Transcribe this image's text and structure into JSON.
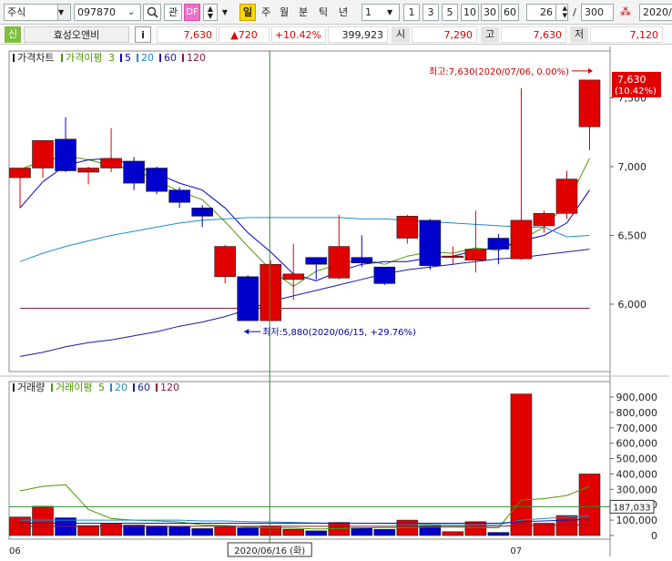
{
  "toolbar": {
    "market": "주식",
    "code": "097870",
    "btn_tube": "관",
    "btn_df": "DF",
    "periods": [
      "일",
      "주",
      "월",
      "분",
      "틱",
      "년"
    ],
    "interval_value": "1",
    "quick_counts": [
      "1",
      "3",
      "5",
      "10",
      "30",
      "60"
    ],
    "view_count": "26",
    "separator": "/",
    "total_count": "300",
    "date_partial": "2020/"
  },
  "info": {
    "tag": "신",
    "name": "효성오앤비",
    "info_btn": "i",
    "price": "7,630",
    "change": "▲720",
    "change_pct": "+10.42%",
    "volume": "399,923",
    "open_label": "시",
    "open": "7,290",
    "high_label": "고",
    "high": "7,630",
    "low_label": "저",
    "low": "7,120"
  },
  "colors": {
    "up": "#e00000",
    "down": "#0000cc",
    "ma3": "#4a9a00",
    "ma5": "#0000cc",
    "ma20": "#1e8ec8",
    "ma60": "#1a1a9e",
    "ma120": "#8b1a3a",
    "cursor": "#2e8b2e"
  },
  "chart_data": {
    "type": "candlestick",
    "legend_price": {
      "title": "가격차트",
      "ma_title": "가격이평",
      "periods": [
        "3",
        "5",
        "20",
        "60",
        "120"
      ]
    },
    "legend_volume": {
      "title": "거래량",
      "ma_title": "거래이평",
      "periods": [
        "5",
        "20",
        "60",
        "120"
      ]
    },
    "price_ticks": [
      {
        "value": 6000,
        "label": "6,000"
      },
      {
        "value": 6500,
        "label": "6,500"
      },
      {
        "value": 7000,
        "label": "7,000"
      },
      {
        "value": 7500,
        "label": "7,500"
      }
    ],
    "volume_ticks": [
      {
        "value": 0,
        "label": "0"
      },
      {
        "value": 100000,
        "label": "100,000"
      },
      {
        "value": 200000,
        "label": "200,000"
      },
      {
        "value": 300000,
        "label": "300,000"
      },
      {
        "value": 400000,
        "label": "400,000"
      },
      {
        "value": 500000,
        "label": "500,000"
      },
      {
        "value": 600000,
        "label": "600,000"
      },
      {
        "value": 700000,
        "label": "700,000"
      },
      {
        "value": 800000,
        "label": "800,000"
      },
      {
        "value": 900000,
        "label": "900,000"
      }
    ],
    "current_price_label": "7,630",
    "current_pct_label": "(10.42%)",
    "volume_marker_value": 187033,
    "volume_marker_label": "187,033",
    "max_annotation": "최고:7,630(2020/07/06, 0.00%)",
    "min_annotation": "최저:5,880(2020/06/15, +29.76%)",
    "cursor_date_label": "2020/06/16 (화)",
    "x_labels": [
      {
        "index": 0,
        "label": "06"
      },
      {
        "index": 22,
        "label": "07"
      }
    ],
    "cursor_index": 11,
    "candles": [
      {
        "o": 6920,
        "h": 6980,
        "l": 6700,
        "c": 6990,
        "v": 120000
      },
      {
        "o": 6990,
        "h": 7100,
        "l": 6920,
        "c": 7190,
        "v": 190000
      },
      {
        "o": 7200,
        "h": 7360,
        "l": 6960,
        "c": 6970,
        "v": 115000
      },
      {
        "o": 6960,
        "h": 7000,
        "l": 6870,
        "c": 6990,
        "v": 65000
      },
      {
        "o": 6990,
        "h": 7280,
        "l": 6960,
        "c": 7060,
        "v": 80000
      },
      {
        "o": 7040,
        "h": 7070,
        "l": 6830,
        "c": 6880,
        "v": 68000
      },
      {
        "o": 6990,
        "h": 7000,
        "l": 6800,
        "c": 6820,
        "v": 62000
      },
      {
        "o": 6830,
        "h": 6850,
        "l": 6700,
        "c": 6740,
        "v": 58000
      },
      {
        "o": 6700,
        "h": 6720,
        "l": 6560,
        "c": 6640,
        "v": 45000
      },
      {
        "o": 6200,
        "h": 6430,
        "l": 6150,
        "c": 6420,
        "v": 55000
      },
      {
        "o": 6200,
        "h": 6210,
        "l": 5880,
        "c": 5880,
        "v": 50000
      },
      {
        "o": 5880,
        "h": 6320,
        "l": 5880,
        "c": 6290,
        "v": 62000
      },
      {
        "o": 6180,
        "h": 6440,
        "l": 6030,
        "c": 6220,
        "v": 40000
      },
      {
        "o": 6340,
        "h": 6340,
        "l": 6180,
        "c": 6290,
        "v": 30000
      },
      {
        "o": 6190,
        "h": 6650,
        "l": 6180,
        "c": 6420,
        "v": 85000
      },
      {
        "o": 6340,
        "h": 6500,
        "l": 6270,
        "c": 6300,
        "v": 50000
      },
      {
        "o": 6270,
        "h": 6270,
        "l": 6140,
        "c": 6150,
        "v": 40000
      },
      {
        "o": 6480,
        "h": 6650,
        "l": 6440,
        "c": 6640,
        "v": 100000
      },
      {
        "o": 6610,
        "h": 6620,
        "l": 6250,
        "c": 6280,
        "v": 65000
      },
      {
        "o": 6350,
        "h": 6420,
        "l": 6290,
        "c": 6350,
        "v": 25000
      },
      {
        "o": 6320,
        "h": 6680,
        "l": 6230,
        "c": 6400,
        "v": 90000
      },
      {
        "o": 6480,
        "h": 6510,
        "l": 6290,
        "c": 6400,
        "v": 20000
      },
      {
        "o": 6330,
        "h": 7570,
        "l": 6320,
        "c": 6610,
        "v": 920000
      },
      {
        "o": 6570,
        "h": 6680,
        "l": 6520,
        "c": 6660,
        "v": 80000
      },
      {
        "o": 6660,
        "h": 6970,
        "l": 6620,
        "c": 6910,
        "v": 130000
      },
      {
        "o": 7290,
        "h": 7630,
        "l": 7120,
        "c": 7630,
        "v": 399923
      }
    ],
    "ma_price": {
      "p3": [
        6980,
        7040,
        7080,
        7050,
        7010,
        6980,
        6900,
        6820,
        6760,
        6600,
        6420,
        6250,
        6130,
        6240,
        6290,
        6330,
        6290,
        6350,
        6380,
        6370,
        6410,
        6390,
        6470,
        6560,
        6730,
        7060
      ],
      "p5": [
        6700,
        6890,
        7010,
        7050,
        7060,
        7010,
        6950,
        6880,
        6830,
        6700,
        6520,
        6380,
        6220,
        6170,
        6240,
        6290,
        6310,
        6310,
        6340,
        6350,
        6390,
        6410,
        6460,
        6500,
        6590,
        6830
      ],
      "p20": [
        6310,
        6370,
        6420,
        6460,
        6500,
        6530,
        6560,
        6590,
        6610,
        6620,
        6630,
        6630,
        6630,
        6630,
        6630,
        6620,
        6620,
        6610,
        6600,
        6590,
        6580,
        6570,
        6560,
        6560,
        6490,
        6500
      ],
      "p60": [
        5620,
        5650,
        5690,
        5720,
        5740,
        5770,
        5800,
        5840,
        5870,
        5910,
        5960,
        6020,
        6060,
        6100,
        6140,
        6180,
        6220,
        6250,
        6270,
        6290,
        6310,
        6330,
        6340,
        6360,
        6380,
        6400
      ],
      "p120": [
        5970,
        5970,
        5970,
        5970,
        5970,
        5970,
        5970,
        5970,
        5970,
        5970,
        5970,
        5970,
        5970,
        5970,
        5970,
        5970,
        5970,
        5970,
        5970,
        5970,
        5970,
        5970,
        5970,
        5970,
        5970,
        5970
      ]
    },
    "ma_volume": {
      "p5": [
        290000,
        320000,
        330000,
        170000,
        110000,
        100000,
        95000,
        88000,
        70000,
        65000,
        55000,
        50000,
        48000,
        42000,
        45000,
        50000,
        52000,
        52000,
        55000,
        55000,
        52000,
        50000,
        230000,
        240000,
        260000,
        320000
      ],
      "p20": [
        100000,
        100000,
        100000,
        100000,
        100000,
        100000,
        100000,
        100000,
        95000,
        95000,
        90000,
        88000,
        85000,
        82000,
        80000,
        80000,
        78000,
        75000,
        72000,
        70000,
        70000,
        70000,
        100000,
        110000,
        120000,
        125000
      ],
      "p60": [
        80000,
        80000,
        80000,
        80000,
        80000,
        80000,
        80000,
        80000,
        80000,
        80000,
        80000,
        80000,
        80000,
        80000,
        80000,
        80000,
        80000,
        80000,
        80000,
        80000,
        80000,
        80000,
        90000,
        95000,
        100000,
        105000
      ],
      "p120": [
        60000,
        60000,
        60000,
        60000,
        60000,
        60000,
        60000,
        60000,
        60000,
        60000,
        60000,
        60000,
        60000,
        60000,
        60000,
        60000,
        60000,
        60000,
        60000,
        60000,
        60000,
        60000,
        65000,
        66000,
        68000,
        70000
      ]
    }
  }
}
